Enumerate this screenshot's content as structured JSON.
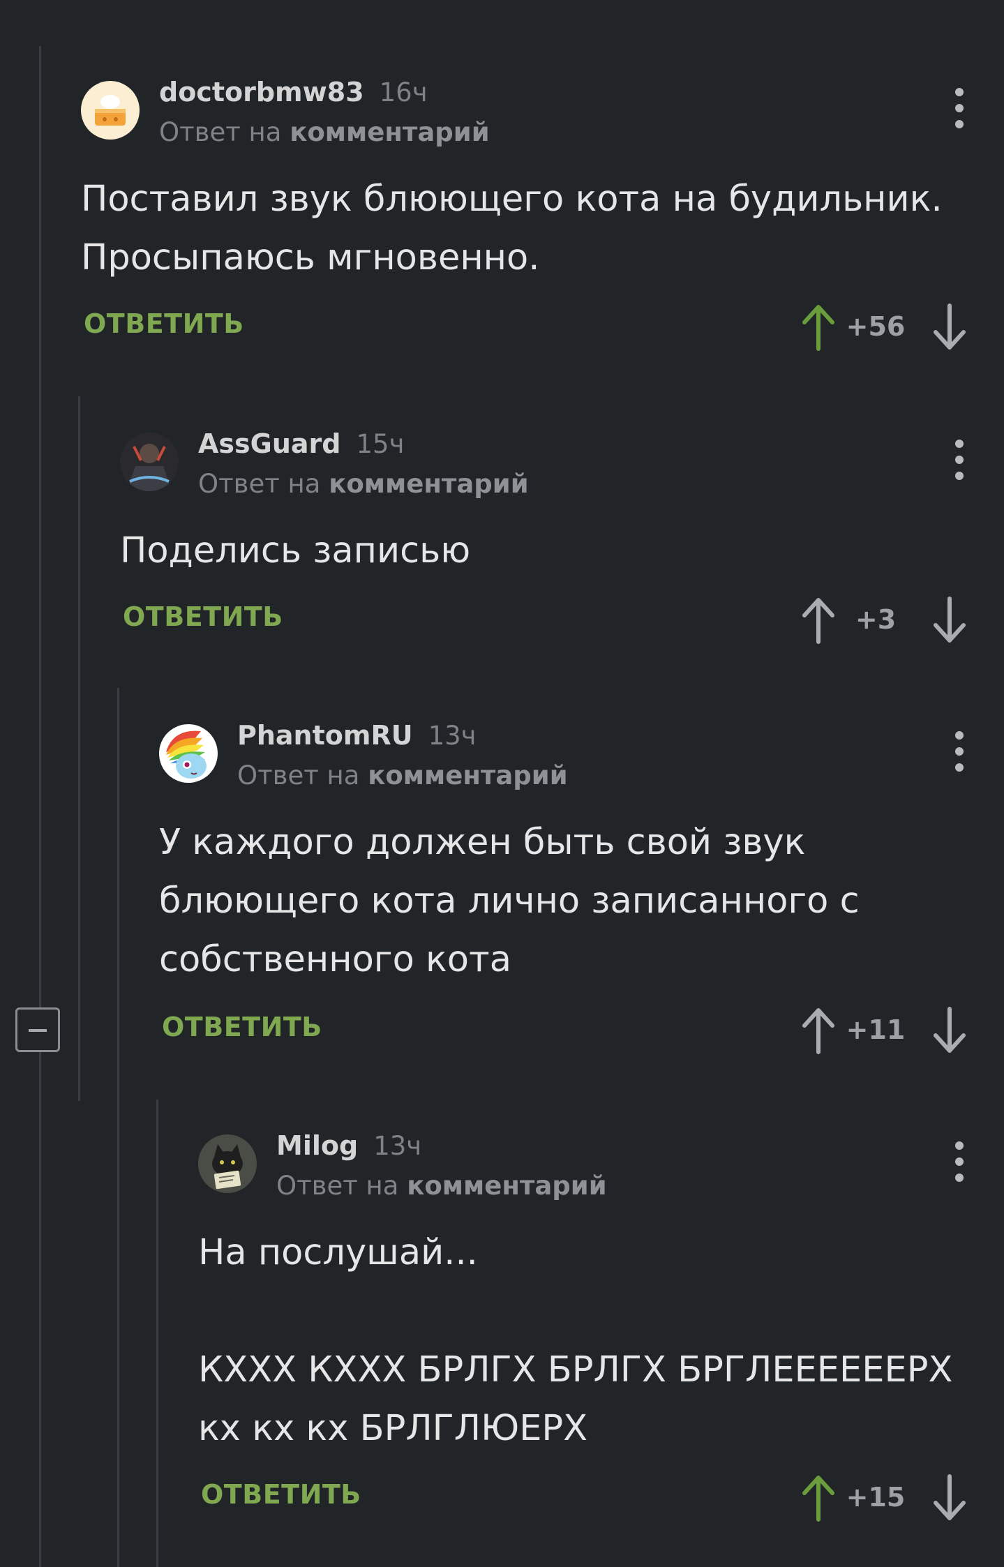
{
  "ui": {
    "reply_prefix": "Ответ на",
    "reply_link": "комментарий",
    "reply_button": "ОТВЕТИТЬ",
    "accent_color": "#7fa850",
    "upvoted_arrow_color": "#6a9e3c",
    "neutral_arrow_color": "#a9acb0"
  },
  "comments": [
    {
      "author": "doctorbmw83",
      "time": "16ч",
      "avatar_icon": "cake-avatar-icon",
      "body": [
        "Поставил звук блюющего кота на будильник.",
        "Просыпаюсь мгновенно."
      ],
      "score": "+56",
      "upvoted": true
    },
    {
      "author": "AssGuard",
      "time": "15ч",
      "avatar_icon": "dark-figure-avatar-icon",
      "body": [
        "Поделись записью"
      ],
      "score": "+3",
      "upvoted": false
    },
    {
      "author": "PhantomRU",
      "time": "13ч",
      "avatar_icon": "rainbow-pony-avatar-icon",
      "body": [
        "У каждого должен быть свой звук",
        "блюющего кота лично записанного с",
        "собственного кота"
      ],
      "score": "+11",
      "upvoted": false
    },
    {
      "author": "Milog",
      "time": "13ч",
      "avatar_icon": "cat-with-sign-avatar-icon",
      "body": [
        "На послушай...",
        "",
        "КХХХ КХХХ БРЛГХ БРЛГХ БРГЛЕЕЕЕЕЕРХ",
        "кх кх кх БРЛГЛЮЕРХ"
      ],
      "score": "+15",
      "upvoted": true
    }
  ]
}
